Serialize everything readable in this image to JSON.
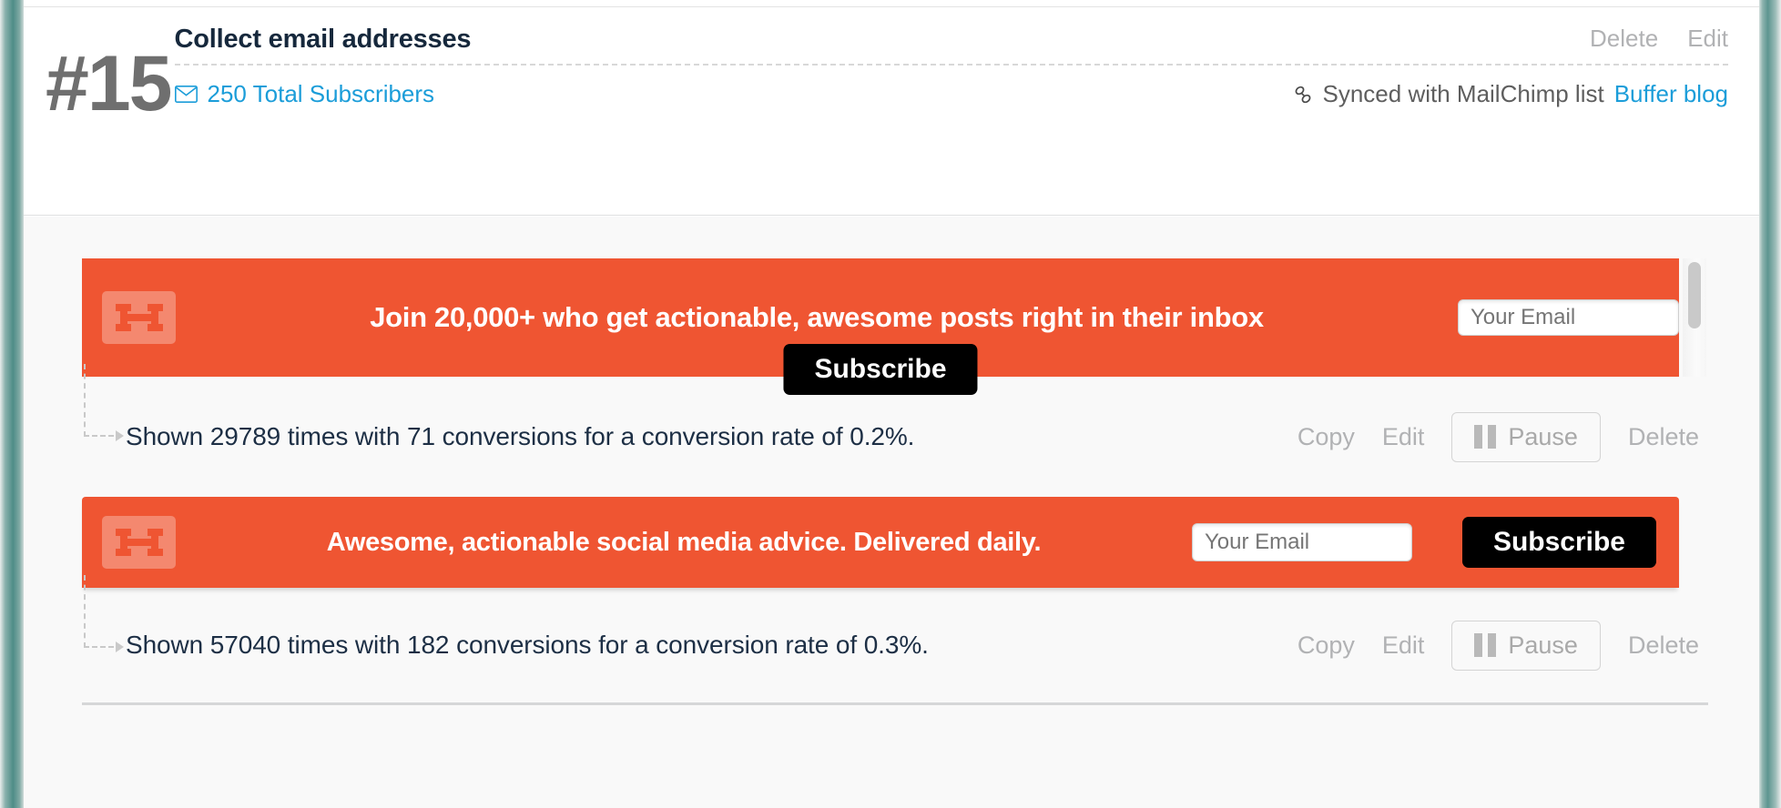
{
  "header": {
    "rank": "#15",
    "title": "Collect email addresses",
    "actions": [
      {
        "label": "Delete",
        "name": "delete"
      },
      {
        "label": "Edit",
        "name": "edit"
      }
    ],
    "subscribers": {
      "icon": "envelope-icon",
      "label": "250 Total Subscribers"
    },
    "sync": {
      "icon": "link-icon",
      "text": "Synced with MailChimp list",
      "list_name": "Buffer blog"
    }
  },
  "accent_colors": {
    "bar_orange": "#ef5532",
    "link_blue": "#1b9dd9",
    "title_navy": "#16283c",
    "muted_grey": "#b1b2b4",
    "button_black": "#000000",
    "chrome_teal": "#4e8c87"
  },
  "bars": [
    {
      "icon": "bar-layout-icon",
      "headline": "Join 20,000+ who get actionable, awesome posts right in their inbox",
      "email_placeholder": "Your Email",
      "email_value": "",
      "subscribe_label": "Subscribe",
      "stats": "Shown 29789 times with 71 conversions for a conversion rate of 0.2%.",
      "stats_numbers": {
        "shown": "29789",
        "conversions": "71",
        "conversion_rate": "0.2%"
      },
      "actions": {
        "copy": "Copy",
        "edit": "Edit",
        "pause": "Pause",
        "delete": "Delete"
      }
    },
    {
      "icon": "bar-layout-icon",
      "headline": "Awesome, actionable social media advice. Delivered daily.",
      "email_placeholder": "Your Email",
      "email_value": "",
      "subscribe_label": "Subscribe",
      "stats": "Shown 57040 times with 182 conversions for a conversion rate of 0.3%.",
      "stats_numbers": {
        "shown": "57040",
        "conversions": "182",
        "conversion_rate": "0.3%"
      },
      "actions": {
        "copy": "Copy",
        "edit": "Edit",
        "pause": "Pause",
        "delete": "Delete"
      }
    }
  ]
}
